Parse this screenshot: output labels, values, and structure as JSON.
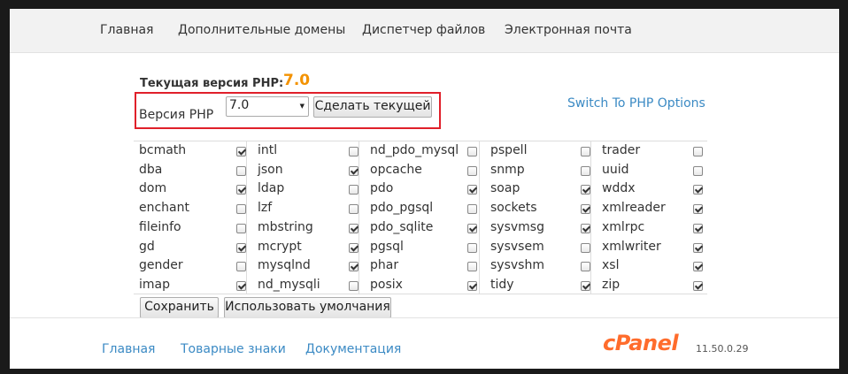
{
  "nav": {
    "items": [
      "Главная",
      "Дополнительные домены",
      "Диспетчер файлов",
      "Электронная почта"
    ]
  },
  "php": {
    "current_label": "Текущая версия PHP:",
    "current_value": "7.0",
    "version_label": "Версия PHP",
    "selected_version": "7.0",
    "make_current_button": "Сделать текущей",
    "switch_link": "Switch To PHP Options"
  },
  "extensions": [
    [
      {
        "name": "bcmath",
        "checked": true
      },
      {
        "name": "dba",
        "checked": false
      },
      {
        "name": "dom",
        "checked": true
      },
      {
        "name": "enchant",
        "checked": false
      },
      {
        "name": "fileinfo",
        "checked": false
      },
      {
        "name": "gd",
        "checked": true
      },
      {
        "name": "gender",
        "checked": false
      },
      {
        "name": "imap",
        "checked": true
      }
    ],
    [
      {
        "name": "intl",
        "checked": false
      },
      {
        "name": "json",
        "checked": true
      },
      {
        "name": "ldap",
        "checked": false
      },
      {
        "name": "lzf",
        "checked": false
      },
      {
        "name": "mbstring",
        "checked": true
      },
      {
        "name": "mcrypt",
        "checked": true
      },
      {
        "name": "mysqlnd",
        "checked": true
      },
      {
        "name": "nd_mysqli",
        "checked": false
      }
    ],
    [
      {
        "name": "nd_pdo_mysql",
        "checked": false
      },
      {
        "name": "opcache",
        "checked": false
      },
      {
        "name": "pdo",
        "checked": true
      },
      {
        "name": "pdo_pgsql",
        "checked": false
      },
      {
        "name": "pdo_sqlite",
        "checked": true
      },
      {
        "name": "pgsql",
        "checked": false
      },
      {
        "name": "phar",
        "checked": false
      },
      {
        "name": "posix",
        "checked": true
      }
    ],
    [
      {
        "name": "pspell",
        "checked": false
      },
      {
        "name": "snmp",
        "checked": false
      },
      {
        "name": "soap",
        "checked": true
      },
      {
        "name": "sockets",
        "checked": true
      },
      {
        "name": "sysvmsg",
        "checked": true
      },
      {
        "name": "sysvsem",
        "checked": false
      },
      {
        "name": "sysvshm",
        "checked": false
      },
      {
        "name": "tidy",
        "checked": true
      }
    ],
    [
      {
        "name": "trader",
        "checked": false
      },
      {
        "name": "uuid",
        "checked": false
      },
      {
        "name": "wddx",
        "checked": true
      },
      {
        "name": "xmlreader",
        "checked": true
      },
      {
        "name": "xmlrpc",
        "checked": true
      },
      {
        "name": "xmlwriter",
        "checked": true
      },
      {
        "name": "xsl",
        "checked": true
      },
      {
        "name": "zip",
        "checked": true
      }
    ]
  ],
  "actions": {
    "save": "Сохранить",
    "defaults": "Использовать умолчания"
  },
  "footer": {
    "links": [
      "Главная",
      "Товарные знаки",
      "Документация"
    ],
    "logo_text": "cPanel",
    "version": "11.50.0.29"
  },
  "colors": {
    "accent_orange": "#f39200",
    "link_blue": "#3b8ac4",
    "highlight_red": "#e0202a",
    "logo_orange": "#ff6c2c"
  }
}
